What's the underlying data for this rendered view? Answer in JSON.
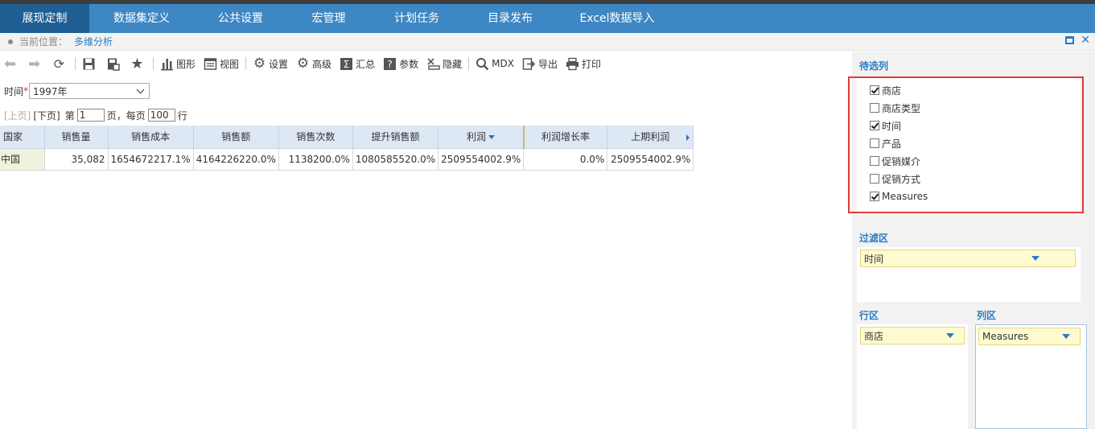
{
  "nav": {
    "tabs": [
      {
        "label": "展现定制",
        "active": true
      },
      {
        "label": "数据集定义"
      },
      {
        "label": "公共设置"
      },
      {
        "label": "宏管理"
      },
      {
        "label": "计划任务"
      },
      {
        "label": "目录发布"
      },
      {
        "label": "Excel数据导入"
      }
    ]
  },
  "breadcrumb": {
    "label": "当前位置：",
    "current": "多维分析"
  },
  "toolbar": {
    "chart": "图形",
    "view": "视图",
    "settings": "设置",
    "advanced": "高级",
    "summary": "汇总",
    "params": "参数",
    "hide": "隐藏",
    "mdx": "MDX",
    "export": "导出",
    "print": "打印"
  },
  "filter": {
    "label": "时间",
    "required_mark": "*",
    "value": "1997年"
  },
  "pager": {
    "prev": "[上页]",
    "next": "[下页]",
    "page_prefix": "第",
    "page_value": "1",
    "page_suffix": "页，每页",
    "per_page_value": "100",
    "per_page_suffix": "行"
  },
  "table": {
    "columns": [
      "国家",
      "销售量",
      "销售成本",
      "销售额",
      "销售次数",
      "提升销售额",
      "利润",
      "利润增长率",
      "上期利润"
    ],
    "rows": [
      [
        "中国",
        "35,082",
        "1654672217.1%",
        "4164226220.0%",
        "1138200.0%",
        "1080585520.0%",
        "2509554002.9%",
        "0.0%",
        "2509554002.9%"
      ]
    ]
  },
  "side": {
    "candidates_title": "待选列",
    "candidates": [
      {
        "label": "商店",
        "checked": true
      },
      {
        "label": "商店类型",
        "checked": false
      },
      {
        "label": "时间",
        "checked": true
      },
      {
        "label": "产品",
        "checked": false
      },
      {
        "label": "促销媒介",
        "checked": false
      },
      {
        "label": "促销方式",
        "checked": false
      },
      {
        "label": "Measures",
        "checked": true
      }
    ],
    "filter_title": "过滤区",
    "filter_chip": "时间",
    "row_title": "行区",
    "row_chip": "商店",
    "col_title": "列区",
    "col_chip": "Measures"
  },
  "colors": {
    "nav_bg": "#3d87c4",
    "nav_active": "#1f5f93",
    "accent_blue": "#2c7ac2",
    "highlight_red": "#e03a3a",
    "chip_bg": "#fffbd0"
  }
}
